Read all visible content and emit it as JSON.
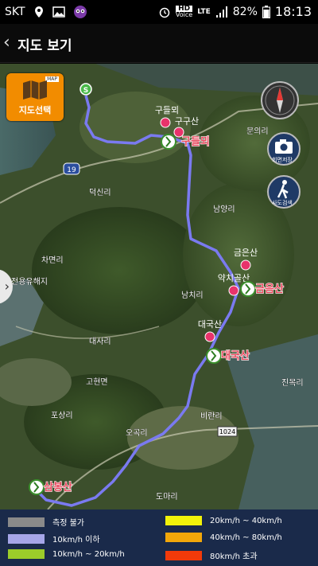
{
  "status": {
    "carrier": "SKT",
    "hd": "HD",
    "voice": "Voice",
    "lte": "LTE",
    "battery": "82%",
    "time": "18:13"
  },
  "header": {
    "back_icon": "chevron-left-icon",
    "title": "지도 보기"
  },
  "controls": {
    "map_select_label": "지도선택",
    "map_tag": "MAP",
    "camera_label": "회면저장",
    "course_label": "사도검색"
  },
  "map": {
    "places": {
      "munuri": "문의리",
      "deoksin": "덕신리",
      "namyang": "남양리",
      "chamyeon": "차면리",
      "jeonyong": "전용유해지",
      "namchi": "남치리",
      "daesa": "대사리",
      "goheon": "고현면",
      "posang": "포상리",
      "ogok": "오곡리",
      "birangni": "비란리",
      "domari": "도마리",
      "jinmok": "진목리",
      "road19": "19",
      "road1024": "1024"
    },
    "peaks": {
      "gudeulmi": "구들뫼",
      "gudeulmi2": "구들뫼",
      "gugu": "구구산",
      "geumeun": "금은산",
      "yakchi": "약치골산",
      "geumeun2": "금음산",
      "daeguk": "대국산",
      "daeguk2": "대국산",
      "sambong": "삼봉산"
    },
    "start_badge": "S"
  },
  "legend": {
    "items": [
      {
        "label": "측정 불가",
        "color": "#8a8a8a"
      },
      {
        "label": "10km/h 이하",
        "color": "#a6a6e8"
      },
      {
        "label": "10km/h ~ 20km/h",
        "color": "#9ccc2a"
      },
      {
        "label": "20km/h ~ 40km/h",
        "color": "#f2f20a"
      },
      {
        "label": "40km/h ~ 80km/h",
        "color": "#f2a70a"
      },
      {
        "label": "80km/h 초과",
        "color": "#f23a0a"
      }
    ]
  },
  "colors": {
    "route": "#7a7af0",
    "accent": "#f28c00",
    "legend_bg": "#1a2a4a"
  }
}
